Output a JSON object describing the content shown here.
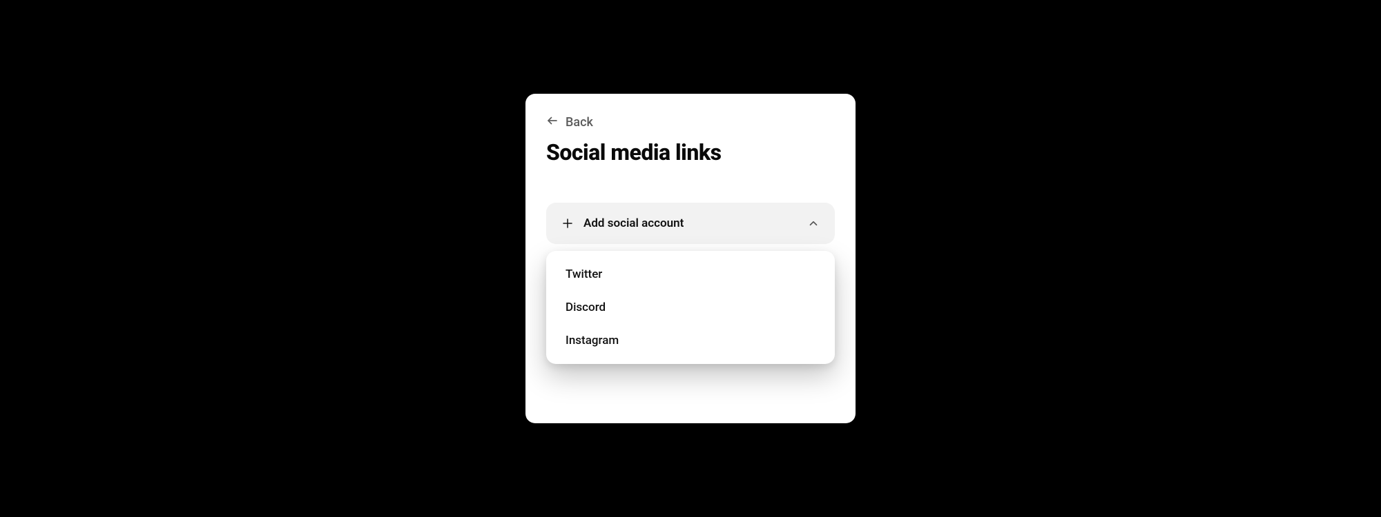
{
  "back": {
    "label": "Back"
  },
  "page": {
    "title": "Social media links"
  },
  "add_social": {
    "label": "Add social account"
  },
  "options": {
    "0": {
      "label": "Twitter"
    },
    "1": {
      "label": "Discord"
    },
    "2": {
      "label": "Instagram"
    }
  }
}
